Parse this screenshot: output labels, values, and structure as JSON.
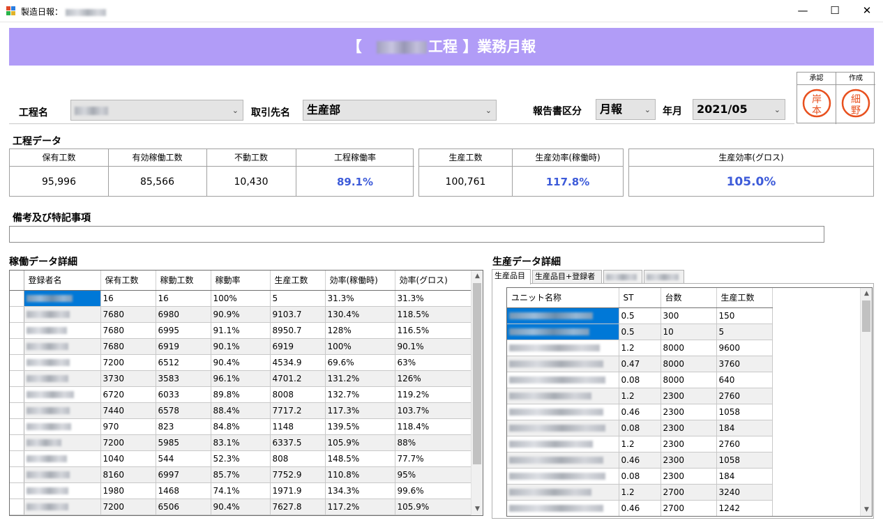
{
  "window": {
    "title": "製造日報：",
    "minimize": "—",
    "maximize": "☐",
    "close": "✕"
  },
  "banner": {
    "open": "【",
    "process_suffix": "工程",
    "close": "】業務月報"
  },
  "stamps": {
    "approve_label": "承認",
    "create_label": "作成",
    "approve_stamp": [
      "岸",
      "本"
    ],
    "create_stamp": [
      "細",
      "野"
    ]
  },
  "filters": {
    "process_label": "工程名",
    "client_label": "取引先名",
    "client_value": "生産部",
    "report_type_label": "報告書区分",
    "report_type_value": "月報",
    "period_label": "年月",
    "period_value": "2021/05"
  },
  "process_data": {
    "title": "工程データ",
    "group1": {
      "headers": [
        "保有工数",
        "有効稼働工数",
        "不動工数",
        "工程稼働率"
      ],
      "values": [
        "95,996",
        "85,566",
        "10,430",
        "89.1%"
      ]
    },
    "group2": {
      "headers": [
        "生産工数",
        "生産効率(稼働時)"
      ],
      "values": [
        "100,761",
        "117.8%"
      ]
    },
    "group3": {
      "headers": [
        "生産効率(グロス)"
      ],
      "values": [
        "105.0%"
      ]
    }
  },
  "remarks": {
    "title": "備考及び特記事項",
    "value": ""
  },
  "operation_detail": {
    "title": "稼働データ詳細",
    "columns": [
      "登録者名",
      "保有工数",
      "稼動工数",
      "稼動率",
      "生産工数",
      "効率(稼働時)",
      "効率(グロス)"
    ],
    "rows": [
      [
        "",
        "16",
        "16",
        "100%",
        "5",
        "31.3%",
        "31.3%"
      ],
      [
        "",
        "7680",
        "6980",
        "90.9%",
        "9103.7",
        "130.4%",
        "118.5%"
      ],
      [
        "",
        "7680",
        "6995",
        "91.1%",
        "8950.7",
        "128%",
        "116.5%"
      ],
      [
        "",
        "7680",
        "6919",
        "90.1%",
        "6919",
        "100%",
        "90.1%"
      ],
      [
        "",
        "7200",
        "6512",
        "90.4%",
        "4534.9",
        "69.6%",
        "63%"
      ],
      [
        "",
        "3730",
        "3583",
        "96.1%",
        "4701.2",
        "131.2%",
        "126%"
      ],
      [
        "",
        "6720",
        "6033",
        "89.8%",
        "8008",
        "132.7%",
        "119.2%"
      ],
      [
        "",
        "7440",
        "6578",
        "88.4%",
        "7717.2",
        "117.3%",
        "103.7%"
      ],
      [
        "",
        "970",
        "823",
        "84.8%",
        "1148",
        "139.5%",
        "118.4%"
      ],
      [
        "",
        "7200",
        "5985",
        "83.1%",
        "6337.5",
        "105.9%",
        "88%"
      ],
      [
        "",
        "1040",
        "544",
        "52.3%",
        "808",
        "148.5%",
        "77.7%"
      ],
      [
        "",
        "8160",
        "6997",
        "85.7%",
        "7752.9",
        "110.8%",
        "95%"
      ],
      [
        "",
        "1980",
        "1468",
        "74.1%",
        "1971.9",
        "134.3%",
        "99.6%"
      ],
      [
        "",
        "7200",
        "6506",
        "90.4%",
        "7627.8",
        "117.2%",
        "105.9%"
      ]
    ]
  },
  "production_detail": {
    "title": "生産データ詳細",
    "tabs": [
      "生産品目",
      "生産品目+登録者",
      "",
      ""
    ],
    "columns": [
      "ユニット名称",
      "ST",
      "台数",
      "生産工数"
    ],
    "rows": [
      [
        "",
        "0.5",
        "300",
        "150"
      ],
      [
        "",
        "0.5",
        "10",
        "5"
      ],
      [
        "",
        "1.2",
        "8000",
        "9600"
      ],
      [
        "",
        "0.47",
        "8000",
        "3760"
      ],
      [
        "",
        "0.08",
        "8000",
        "640"
      ],
      [
        "",
        "1.2",
        "2300",
        "2760"
      ],
      [
        "",
        "0.46",
        "2300",
        "1058"
      ],
      [
        "",
        "0.08",
        "2300",
        "184"
      ],
      [
        "",
        "1.2",
        "2300",
        "2760"
      ],
      [
        "",
        "0.46",
        "2300",
        "1058"
      ],
      [
        "",
        "0.08",
        "2300",
        "184"
      ],
      [
        "",
        "1.2",
        "2700",
        "3240"
      ],
      [
        "",
        "0.46",
        "2700",
        "1242"
      ]
    ]
  },
  "colors": {
    "banner": "#b19cf7",
    "accent_value": "#3d5bd9",
    "selection": "#0078d7",
    "stamp": "#e8501e"
  }
}
